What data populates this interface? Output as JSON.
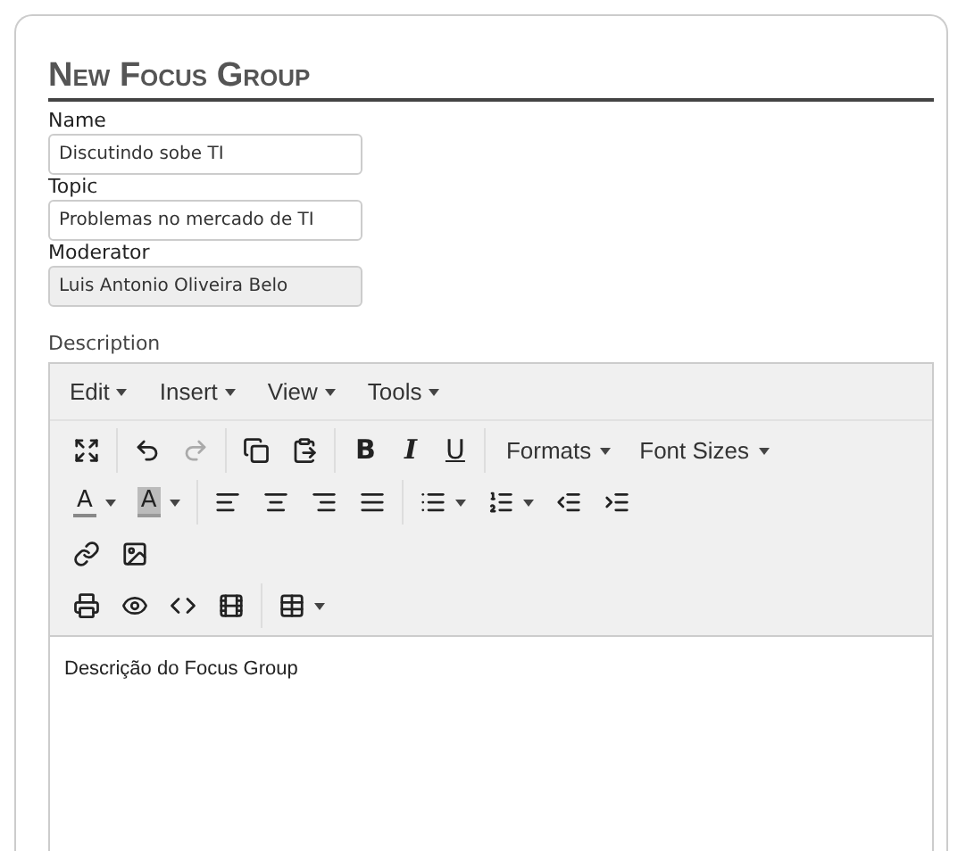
{
  "title": "New Focus Group",
  "fields": [
    {
      "label": "Name",
      "value": "Discutindo sobe TI",
      "disabled": false
    },
    {
      "label": "Topic",
      "value": "Problemas no mercado de TI",
      "disabled": false
    },
    {
      "label": "Moderator",
      "value": "Luis Antonio Oliveira Belo",
      "disabled": true
    }
  ],
  "editor": {
    "label": "Description",
    "menus": [
      "Edit",
      "Insert",
      "View",
      "Tools"
    ],
    "toolbar": [
      [
        [
          {
            "kind": "icon"
          }
        ],
        [
          {
            "kind": "icon",
            "disabled": false
          },
          {
            "kind": "icon",
            "disabled": true
          }
        ],
        [
          {
            "kind": "icon"
          },
          {
            "kind": "icon"
          }
        ],
        [
          {
            "kind": "bold",
            "label": "B"
          },
          {
            "kind": "italic",
            "label": "I"
          },
          {
            "kind": "underline",
            "label": "U"
          }
        ],
        [
          {
            "kind": "menu",
            "label": "Formats"
          },
          {
            "kind": "menu",
            "label": "Font Sizes"
          }
        ]
      ],
      [
        [
          {
            "kind": "forecolor",
            "label": "A"
          },
          {
            "kind": "backcolor",
            "label": "A"
          }
        ],
        [
          {
            "kind": "icon"
          },
          {
            "kind": "icon"
          },
          {
            "kind": "icon"
          },
          {
            "kind": "icon"
          }
        ],
        [
          {
            "kind": "split"
          },
          {
            "kind": "split"
          },
          {
            "kind": "icon"
          },
          {
            "kind": "icon"
          }
        ]
      ],
      [
        [
          {
            "kind": "icon"
          },
          {
            "kind": "icon"
          }
        ]
      ],
      [
        [
          {
            "kind": "icon"
          },
          {
            "kind": "icon"
          },
          {
            "kind": "icon"
          },
          {
            "kind": "icon"
          }
        ],
        [
          {
            "kind": "split"
          }
        ]
      ]
    ],
    "content": "Descrição do Focus Group"
  }
}
